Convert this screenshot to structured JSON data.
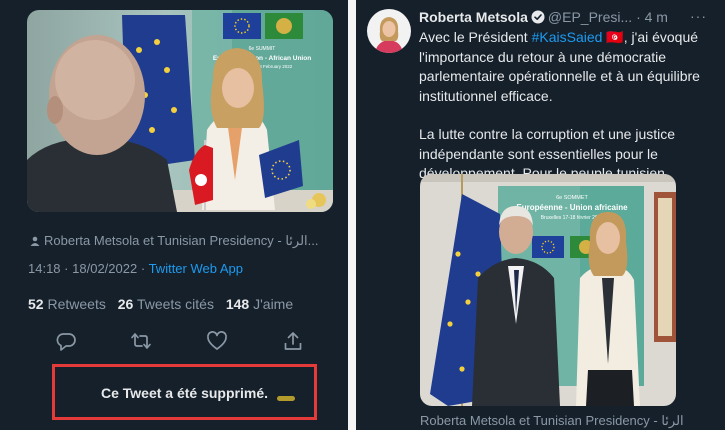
{
  "left_tweet": {
    "tag_line": "Roberta Metsola et Tunisian Presidency - الرئا...",
    "time": "14:18",
    "date": "18/02/2022",
    "sep": "·",
    "source": "Twitter Web App",
    "retweets_count": "52",
    "retweets_label": "Retweets",
    "quotes_count": "26",
    "quotes_label": "Tweets cités",
    "likes_count": "148",
    "likes_label": "J'aime",
    "deleted_notice": "Ce Tweet a été supprimé.",
    "photo_banner": {
      "line1": "6e SUMMIT",
      "line2": "European Union - African Union",
      "line3": "Brussels 17-18 February 2022"
    }
  },
  "right_tweet": {
    "author_name": "Roberta Metsola",
    "author_handle": "@EP_Presi...",
    "time_ago": "· 4 m",
    "more": "···",
    "text_intro": "Avec le Président ",
    "hashtag": "#KaisSaied",
    "flag_emoji": "🇹🇳",
    "text_rest": ", j'ai évoqué l'importance du retour à une démocratie parlementaire opérationnelle et à un équilibre institutionnel efficace.",
    "paragraph2": "La lutte contre la corruption et une justice indépendante sont essentielles pour le développement. Pour le peuple tunisien",
    "caption": "Roberta Metsola et Tunisian Presidency - الرئا",
    "photo_banner": {
      "line1": "6e SOMMET",
      "line2": "Européenne - Union africaine",
      "line3": "Bruxelles 17-18 février 2022"
    }
  },
  "colors": {
    "background": "#15202b",
    "text": "#e7e9ea",
    "muted": "#8b98a5",
    "link": "#1d9bf0",
    "highlight_box": "#e53a3a"
  }
}
